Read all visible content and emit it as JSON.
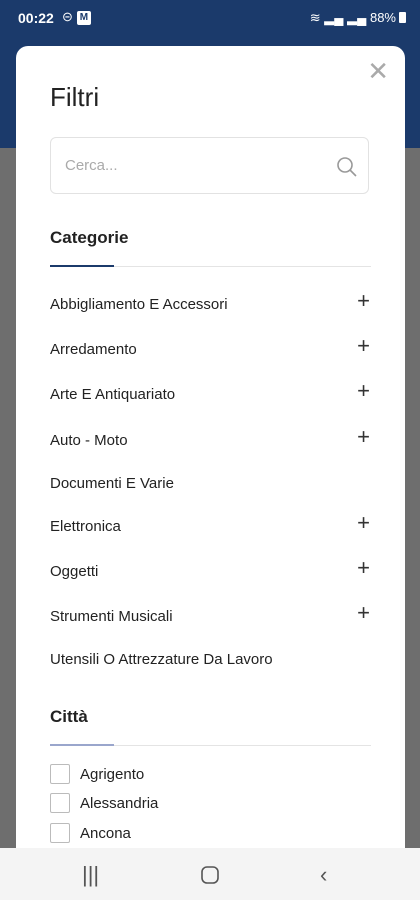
{
  "status": {
    "time": "00:22",
    "battery": "88%"
  },
  "modal": {
    "title": "Filtri",
    "search_placeholder": "Cerca..."
  },
  "categories_section": {
    "title": "Categorie",
    "items": [
      {
        "label": "Abbigliamento E Accessori",
        "expandable": true
      },
      {
        "label": "Arredamento",
        "expandable": true
      },
      {
        "label": "Arte E Antiquariato",
        "expandable": true
      },
      {
        "label": "Auto - Moto",
        "expandable": true
      },
      {
        "label": "Documenti E Varie",
        "expandable": false
      },
      {
        "label": "Elettronica",
        "expandable": true
      },
      {
        "label": "Oggetti",
        "expandable": true
      },
      {
        "label": "Strumenti Musicali",
        "expandable": true
      },
      {
        "label": "Utensili O Attrezzature Da Lavoro",
        "expandable": false
      }
    ]
  },
  "cities_section": {
    "title": "Città",
    "items": [
      {
        "label": "Agrigento",
        "checked": false
      },
      {
        "label": "Alessandria",
        "checked": false
      },
      {
        "label": "Ancona",
        "checked": false
      }
    ]
  },
  "icons": {
    "close": "close-icon",
    "search": "search-icon",
    "plus": "plus-icon",
    "nav_recents": "recents-icon",
    "nav_home": "home-icon",
    "nav_back": "back-icon"
  }
}
